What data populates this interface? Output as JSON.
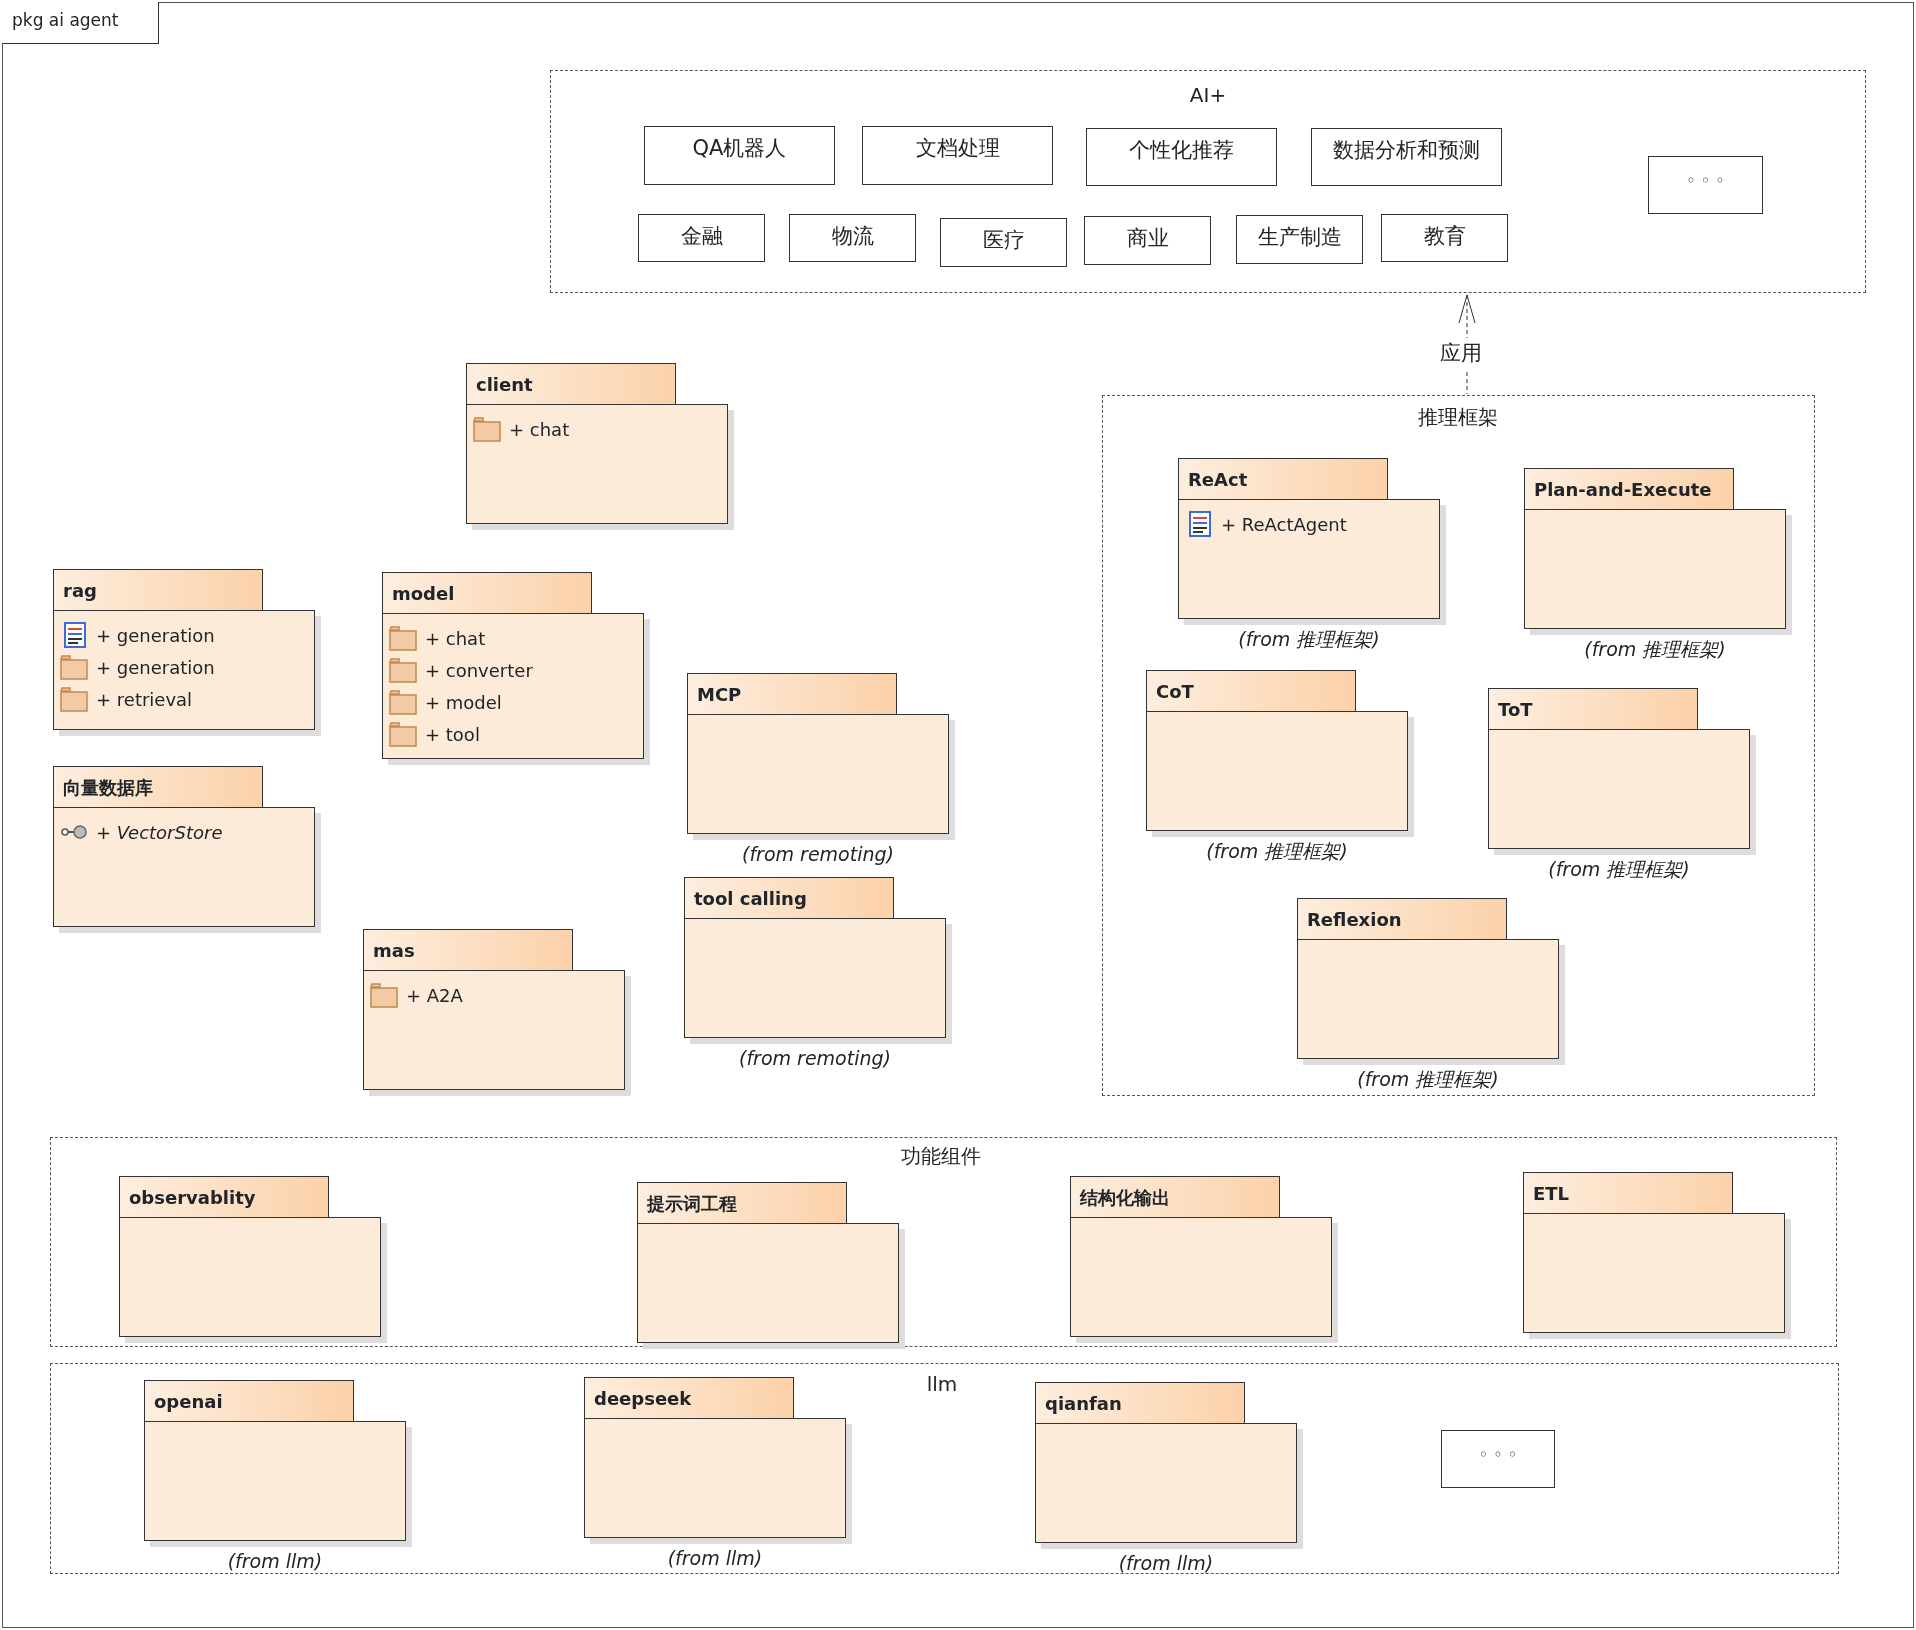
{
  "frame_label": "pkg ai agent",
  "ai_plus": {
    "title": "AI+",
    "items": [
      {
        "label": "QA机器人"
      },
      {
        "label": "文档处理"
      },
      {
        "label": "个性化推荐"
      },
      {
        "label": "数据分析和预测"
      },
      {
        "label": "金融"
      },
      {
        "label": "物流"
      },
      {
        "label": "医疗"
      },
      {
        "label": "商业"
      },
      {
        "label": "生产制造"
      },
      {
        "label": "教育"
      }
    ],
    "more": "◦ ◦ ◦"
  },
  "dependency": {
    "label": "应用"
  },
  "frames": [
    {
      "title": "推理框架"
    },
    {
      "title": "功能组件"
    },
    {
      "title": "llm"
    }
  ],
  "packages": [
    {
      "name": "client",
      "members": [
        {
          "kind": "package",
          "label": "+ chat"
        }
      ]
    },
    {
      "name": "rag",
      "members": [
        {
          "kind": "class",
          "label": "+ generation"
        },
        {
          "kind": "package",
          "label": "+ generation"
        },
        {
          "kind": "package",
          "label": "+ retrieval"
        }
      ]
    },
    {
      "name": "向量数据库",
      "members": [
        {
          "kind": "interface",
          "label": "+ VectorStore"
        }
      ]
    },
    {
      "name": "model",
      "members": [
        {
          "kind": "package",
          "label": "+ chat"
        },
        {
          "kind": "package",
          "label": "+ converter"
        },
        {
          "kind": "package",
          "label": "+ model"
        },
        {
          "kind": "package",
          "label": "+ tool"
        }
      ]
    },
    {
      "name": "mas",
      "members": [
        {
          "kind": "package",
          "label": "+ A2A"
        }
      ]
    },
    {
      "name": "MCP",
      "from": "(from remoting)"
    },
    {
      "name": "tool calling",
      "from": "(from remoting)"
    },
    {
      "name": "ReAct",
      "members": [
        {
          "kind": "class",
          "label": "+ ReActAgent"
        }
      ],
      "from": "(from 推理框架)"
    },
    {
      "name": "Plan-and-Execute",
      "from": "(from 推理框架)"
    },
    {
      "name": "CoT",
      "from": "(from 推理框架)"
    },
    {
      "name": "ToT",
      "from": "(from 推理框架)"
    },
    {
      "name": "Reflexion",
      "from": "(from 推理框架)"
    },
    {
      "name": "observablity"
    },
    {
      "name": "提示词工程"
    },
    {
      "name": "结构化输出"
    },
    {
      "name": "ETL"
    },
    {
      "name": "openai",
      "from": "(from llm)"
    },
    {
      "name": "deepseek",
      "from": "(from llm)"
    },
    {
      "name": "qianfan",
      "from": "(from llm)"
    }
  ],
  "llm_more": "◦ ◦ ◦"
}
